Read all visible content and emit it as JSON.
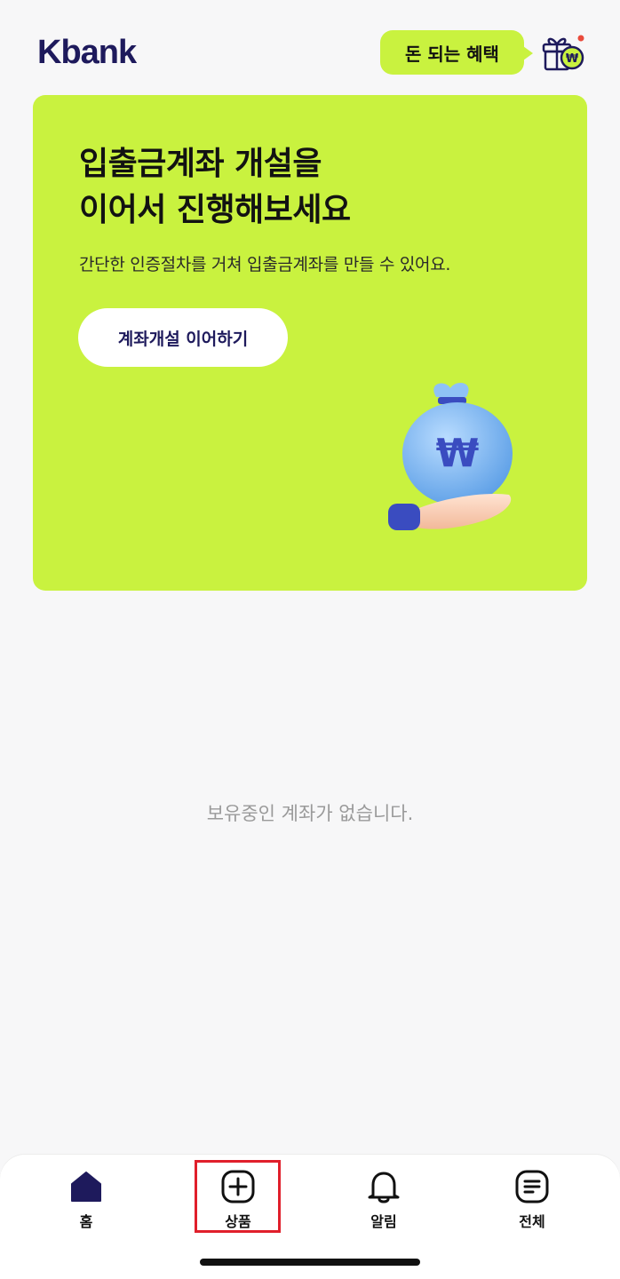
{
  "header": {
    "logo": "Kbank",
    "benefit_label": "돈 되는 혜택",
    "gift_icon": "gift-won-icon",
    "gift_badge_color": "#e94b3c"
  },
  "promo": {
    "title_line1": "입출금계좌 개설을",
    "title_line2": "이어서 진행해보세요",
    "subtitle": "간단한 인증절차를 거쳐 입출금계좌를 만들 수 있어요.",
    "button_label": "계좌개설 이어하기",
    "illustration": "money-bag-in-hand",
    "background_color": "#c9f23f"
  },
  "main": {
    "empty_message": "보유중인 계좌가 없습니다."
  },
  "tabbar": {
    "tabs": [
      {
        "label": "홈",
        "icon": "home-icon",
        "active": true
      },
      {
        "label": "상품",
        "icon": "plus-square-icon",
        "active": false
      },
      {
        "label": "알림",
        "icon": "bell-icon",
        "active": false
      },
      {
        "label": "전체",
        "icon": "menu-list-icon",
        "active": false
      }
    ],
    "active_color": "#1e1a5c"
  }
}
